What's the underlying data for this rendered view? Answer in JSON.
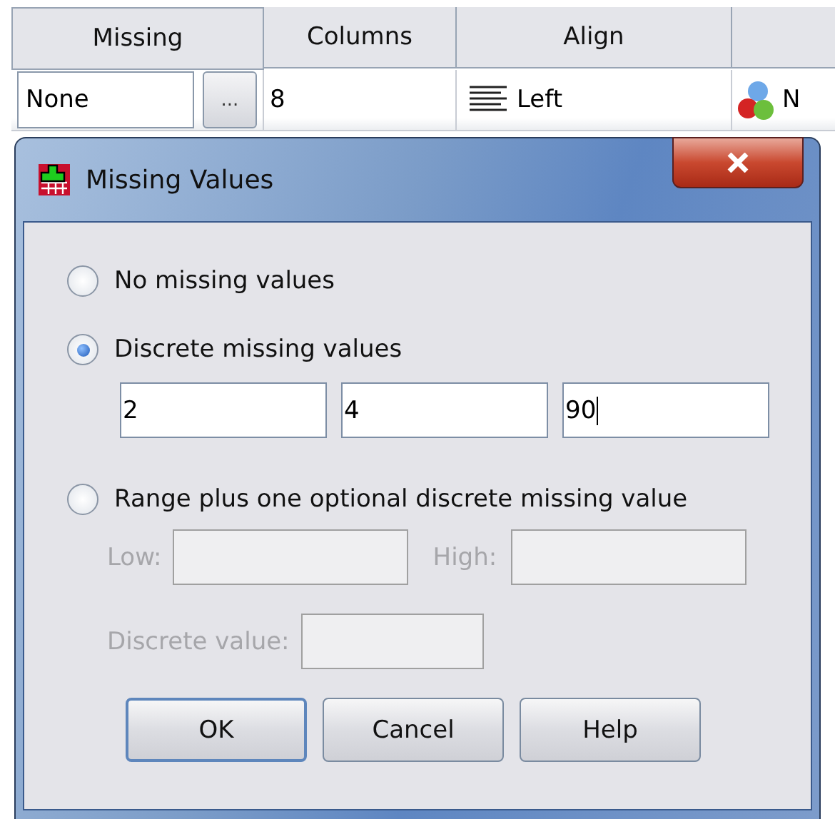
{
  "grid": {
    "columns": [
      "Missing",
      "Columns",
      "Align"
    ],
    "cells": [
      {
        "kind": "button-field",
        "value": "None",
        "button": "..."
      },
      {
        "kind": "text",
        "value": "8"
      },
      {
        "kind": "align",
        "value": "Left"
      },
      {
        "kind": "measure",
        "value": "N"
      }
    ]
  },
  "dialog": {
    "title": "Missing Values",
    "options": [
      {
        "label": "No missing values",
        "selected": false
      },
      {
        "label": "Discrete missing values",
        "selected": true,
        "fields": [
          {
            "value": "2",
            "focused": false
          },
          {
            "value": "4",
            "focused": false
          },
          {
            "value": "90",
            "focused": true
          }
        ]
      },
      {
        "label": "Range plus one optional discrete missing value",
        "selected": false,
        "range": {
          "disabled": true,
          "low": {
            "label": "Low:"
          },
          "high": {
            "label": "High:"
          },
          "discrete": {
            "label": "Discrete value:"
          }
        }
      }
    ],
    "buttons": [
      {
        "label": "OK",
        "default": true
      },
      {
        "label": "Cancel",
        "default": false
      },
      {
        "label": "Help",
        "default": false
      }
    ]
  }
}
